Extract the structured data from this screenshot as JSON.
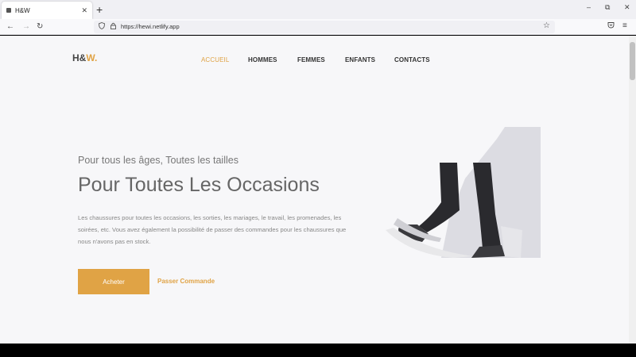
{
  "browser": {
    "tab_title": "H&W",
    "tab_close": "✕",
    "new_tab": "+",
    "url": "https://hewi.netlify.app",
    "window": {
      "minimize": "–",
      "restore": "⧉",
      "close": "✕"
    },
    "nav": {
      "back": "←",
      "forward": "→",
      "reload": "↻"
    }
  },
  "site": {
    "logo": {
      "main": "H&",
      "accent": "W",
      "dot": "."
    },
    "menu": [
      {
        "label": "ACCUEIL",
        "active": true
      },
      {
        "label": "HOMMES"
      },
      {
        "label": "FEMMES"
      },
      {
        "label": "ENFANTS"
      },
      {
        "label": "CONTACTS"
      }
    ],
    "hero": {
      "subtitle": "Pour tous les âges, Toutes les tailles",
      "headline": "Pour Toutes Les Occasions",
      "description": "Les chaussures pour toutes les occasions, les sorties, les mariages, le travail, les promenades, les soirées, etc. Vous avez également la possibilité de passer des commandes pour les chaussures que nous n'avons pas en stock.",
      "primary_button": "Acheter",
      "secondary_link": "Passer Commande"
    },
    "accent_color": "#e0a345"
  }
}
